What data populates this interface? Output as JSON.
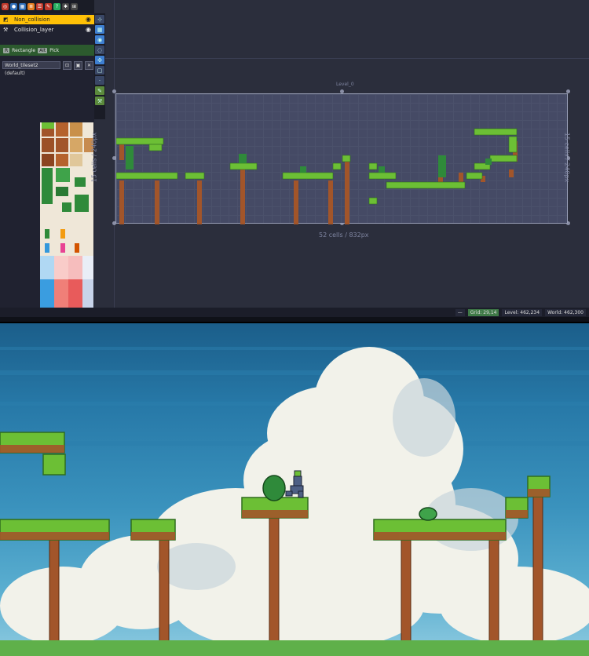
{
  "editor": {
    "toolbar_icons": [
      "world-icon",
      "pin-icon",
      "grid-icon",
      "layers-icon",
      "list-icon",
      "wrench-icon",
      "help-icon",
      "gear-icon",
      "expand-icon"
    ],
    "layers": [
      {
        "name": "Non_collision",
        "selected": true
      },
      {
        "name": "Collision_layer",
        "selected": false
      }
    ],
    "modes": {
      "rect_label": "Rectangle",
      "pick_label": "Pick"
    },
    "tileset": {
      "selected": "World_tileset2 (default)"
    },
    "level": {
      "title": "Level_0",
      "width_label": "52 cells / 832px",
      "height_label": "15 cells / 240px"
    },
    "status": {
      "grid": "Grid: 29,14",
      "level": "Level: 462,234",
      "world": "World: 462,300"
    },
    "colors": {
      "accent": "#ffc107",
      "panel": "#202230",
      "canvas": "#2b2e3c",
      "level": "#454a65",
      "grass": "#6cbf35",
      "dirt": "#a2552a"
    }
  },
  "game": {
    "colors": {
      "sky_top": "#1b5e8a",
      "sky_bottom": "#8fcbe0",
      "cloud": "#f2f2ea"
    }
  }
}
